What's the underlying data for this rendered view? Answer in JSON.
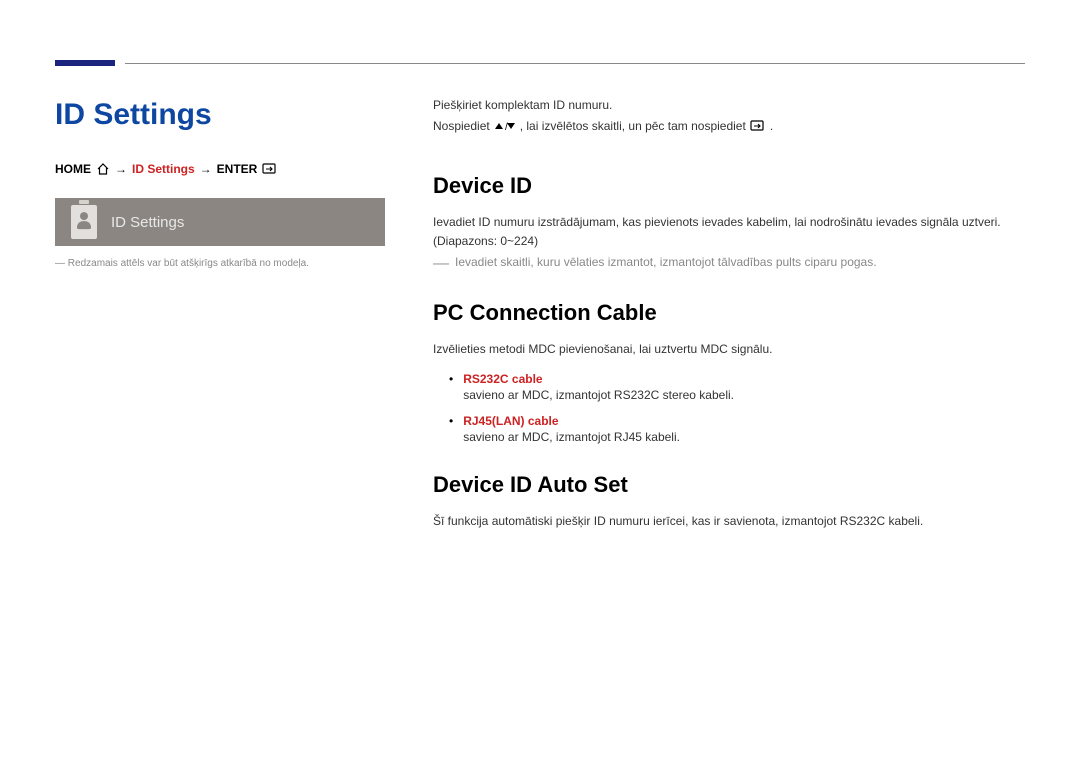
{
  "sidebar": {
    "title": "ID Settings",
    "breadcrumb": {
      "home": "HOME",
      "mid": "ID Settings",
      "enter": "ENTER"
    },
    "screenshot_label": "ID Settings",
    "caption_dash": "―",
    "caption": "Redzamais attēls var būt atšķirīgs atkarībā no modeļa."
  },
  "content": {
    "intro_line1": "Piešķiriet komplektam ID numuru.",
    "intro_line2_a": "Nospiediet",
    "intro_line2_b": ", lai izvēlētos skaitli, un pēc tam nospiediet",
    "intro_line2_c": ".",
    "sections": {
      "device_id": {
        "heading": "Device ID",
        "body": "Ievadiet ID numuru izstrādājumam, kas pievienots ievades kabelim, lai nodrošinātu ievades signāla uztveri. (Diapazons: 0~224)",
        "note": "Ievadiet skaitli, kuru vēlaties izmantot, izmantojot tālvadības pults ciparu pogas."
      },
      "pc_conn": {
        "heading": "PC Connection Cable",
        "body": "Izvēlieties metodi MDC pievienošanai, lai uztvertu MDC signālu.",
        "items": [
          {
            "label": "RS232C cable",
            "desc": "savieno ar MDC, izmantojot RS232C stereo kabeli."
          },
          {
            "label": "RJ45(LAN) cable",
            "desc": "savieno ar MDC, izmantojot RJ45 kabeli."
          }
        ]
      },
      "auto_set": {
        "heading": "Device ID Auto Set",
        "body": "Šī funkcija automātiski piešķir ID numuru ierīcei, kas ir savienota, izmantojot RS232C kabeli."
      }
    }
  }
}
